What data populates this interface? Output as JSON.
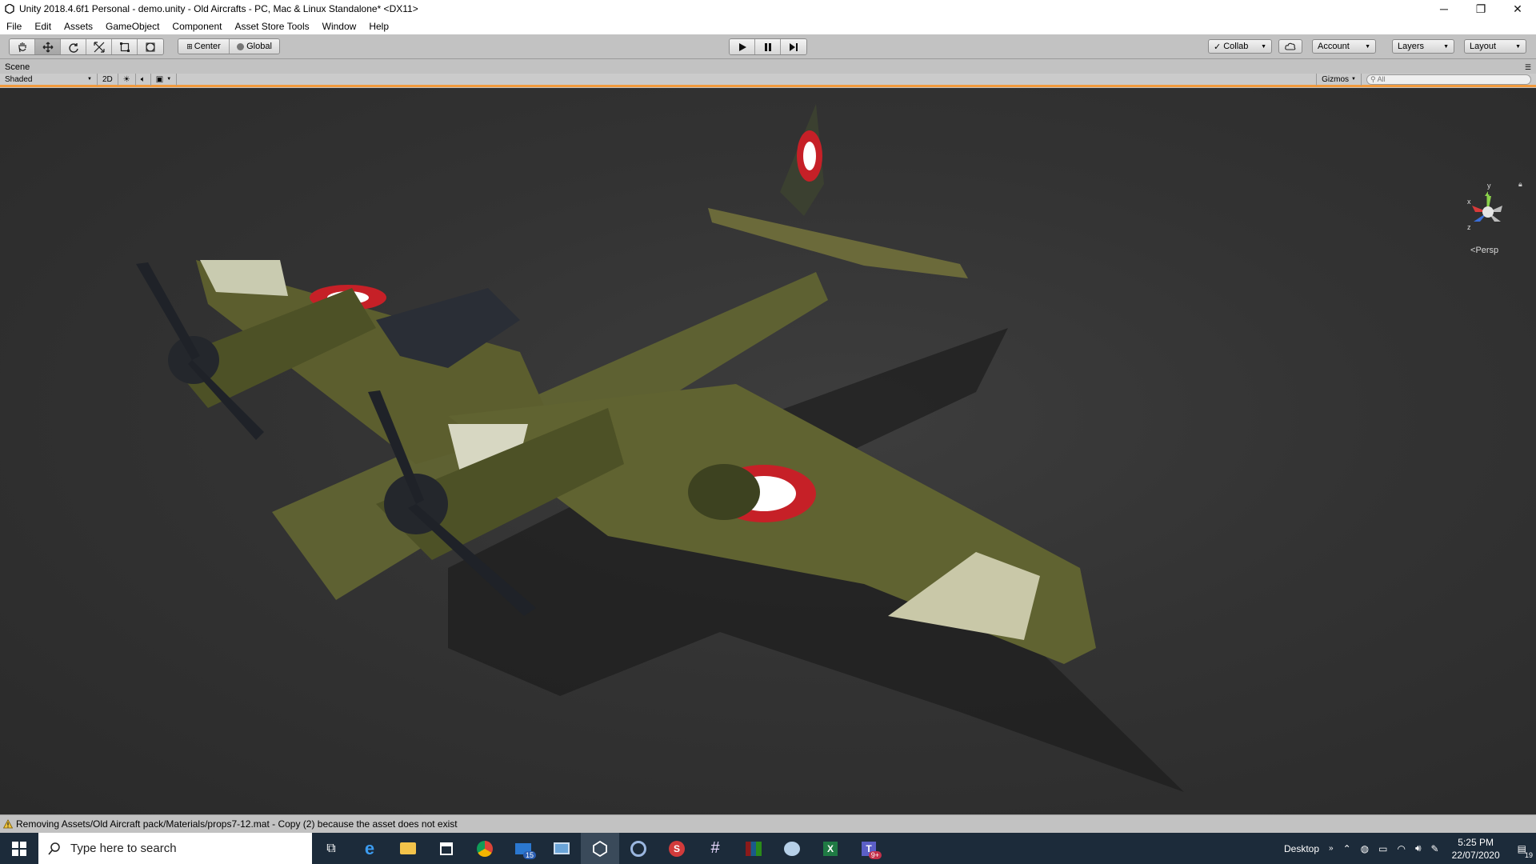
{
  "window": {
    "title": "Unity 2018.4.6f1 Personal - demo.unity - Old Aircrafts - PC, Mac & Linux Standalone* <DX11>",
    "minimize": "─",
    "restore": "❐",
    "close": "✕"
  },
  "menu": [
    "File",
    "Edit",
    "Assets",
    "GameObject",
    "Component",
    "Asset Store Tools",
    "Window",
    "Help"
  ],
  "toolbar": {
    "pivot_mode": "Center",
    "pivot_rotation": "Global",
    "collab": "Collab",
    "account": "Account",
    "layers": "Layers",
    "layout": "Layout"
  },
  "scene": {
    "tab_label": "Scene",
    "draw_mode": "Shaded",
    "mode_2d": "2D",
    "gizmos": "Gizmos",
    "search_placeholder": "All",
    "persp_label": "Persp",
    "axis_x": "x",
    "axis_y": "y",
    "axis_z": "z"
  },
  "status": {
    "message": "Removing Assets/Old Aircraft pack/Materials/props7-12.mat - Copy (2) because the asset does not exist"
  },
  "taskbar": {
    "search_placeholder": "Type here to search",
    "mail_badge": "15",
    "teams_badge": "9+",
    "desktop_label": "Desktop",
    "time": "5:25 PM",
    "date": "22/07/2020",
    "notifications": "19"
  },
  "colors": {
    "accent_orange": "#f29a3c",
    "taskbar": "#1c2b3a",
    "viewport": "#333333"
  }
}
